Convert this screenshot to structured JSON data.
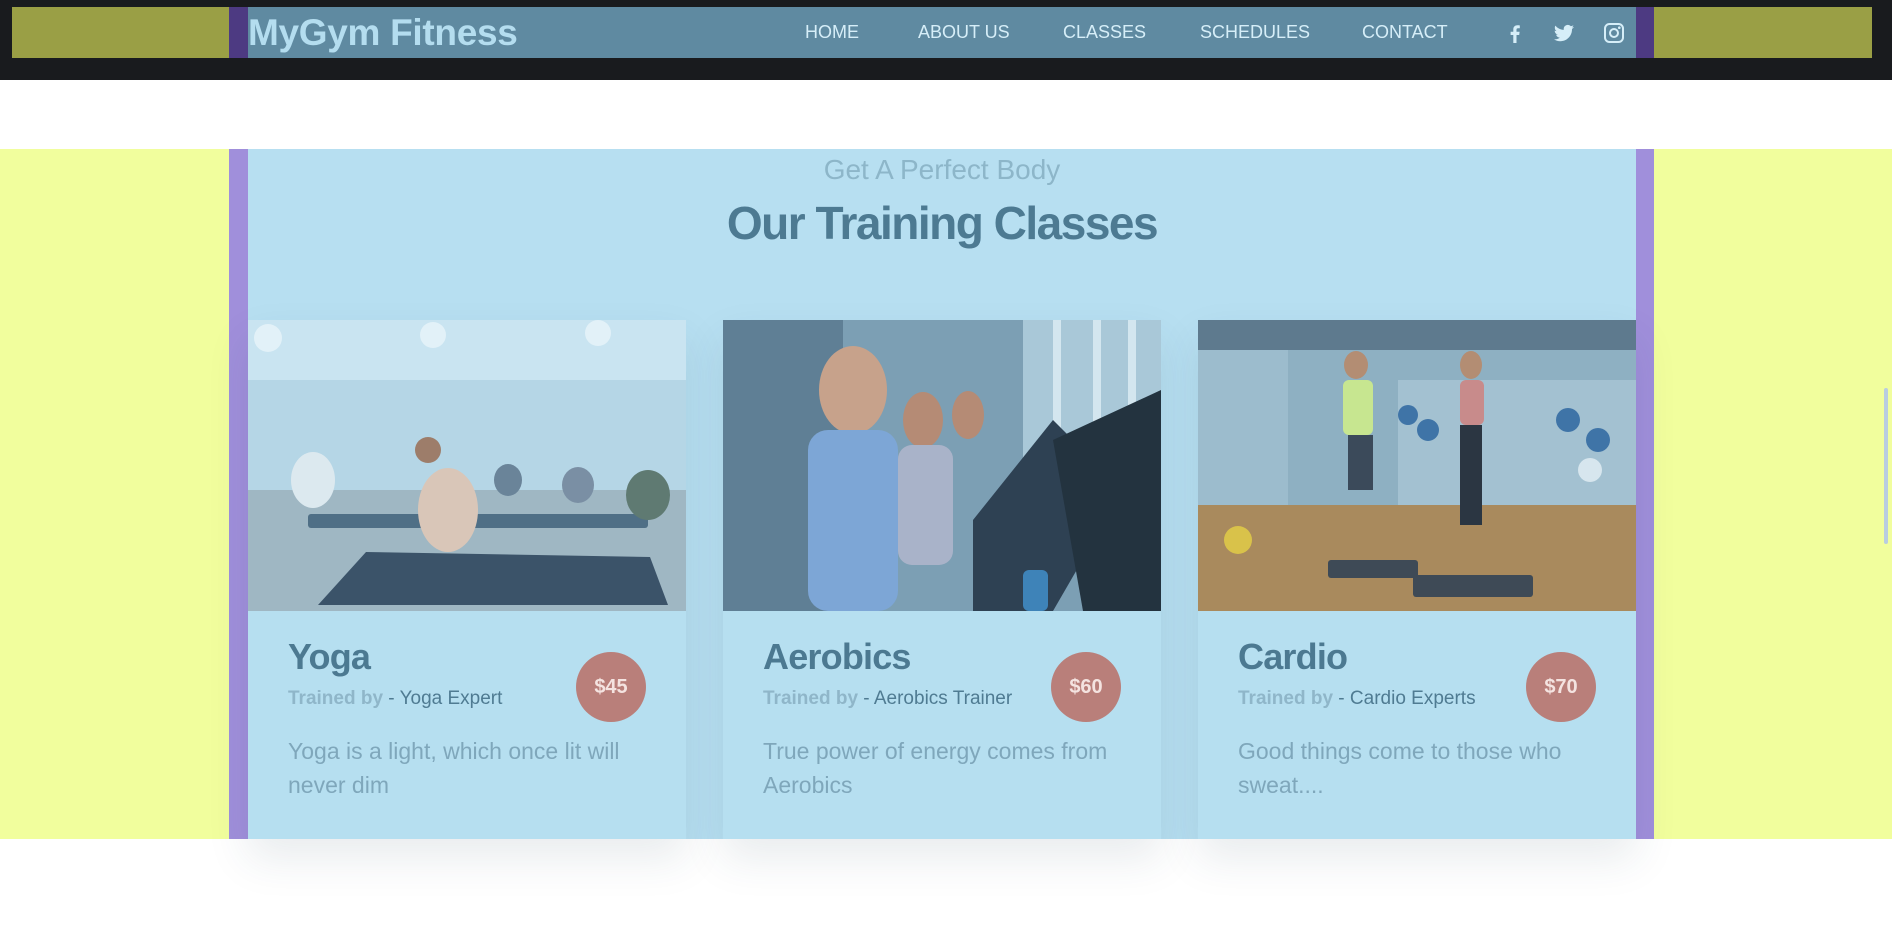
{
  "header": {
    "brand": "MyGym Fitness",
    "nav": [
      "HOME",
      "ABOUT US",
      "CLASSES",
      "SCHEDULES",
      "CONTACT"
    ],
    "social_icons": [
      "facebook-icon",
      "twitter-icon",
      "instagram-icon"
    ]
  },
  "section": {
    "subtitle": "Get A Perfect Body",
    "title": "Our Training Classes"
  },
  "classes": [
    {
      "name": "Yoga",
      "trained_by_label": "Trained by",
      "trainer": " - Yoga Expert",
      "price": "$45",
      "description": "Yoga is a light, which once lit will never dim",
      "image": "yoga-class-photo"
    },
    {
      "name": "Aerobics",
      "trained_by_label": "Trained by",
      "trainer": " - Aerobics Trainer",
      "price": "$60",
      "description": "True power of energy comes from Aerobics",
      "image": "aerobics-class-photo"
    },
    {
      "name": "Cardio",
      "trained_by_label": "Trained by",
      "trainer": " - Cardio Experts",
      "price": "$70",
      "description": "Good things come to those who sweat....",
      "image": "cardio-class-photo"
    }
  ],
  "colors": {
    "header_bg": "#5f8aa1",
    "section_bg": "#b7dff1",
    "accent_price": "#b97f7a",
    "side_band": "#f1fe9d",
    "side_olive": "#9a9f45",
    "frame_purple": "#a08fdb"
  }
}
